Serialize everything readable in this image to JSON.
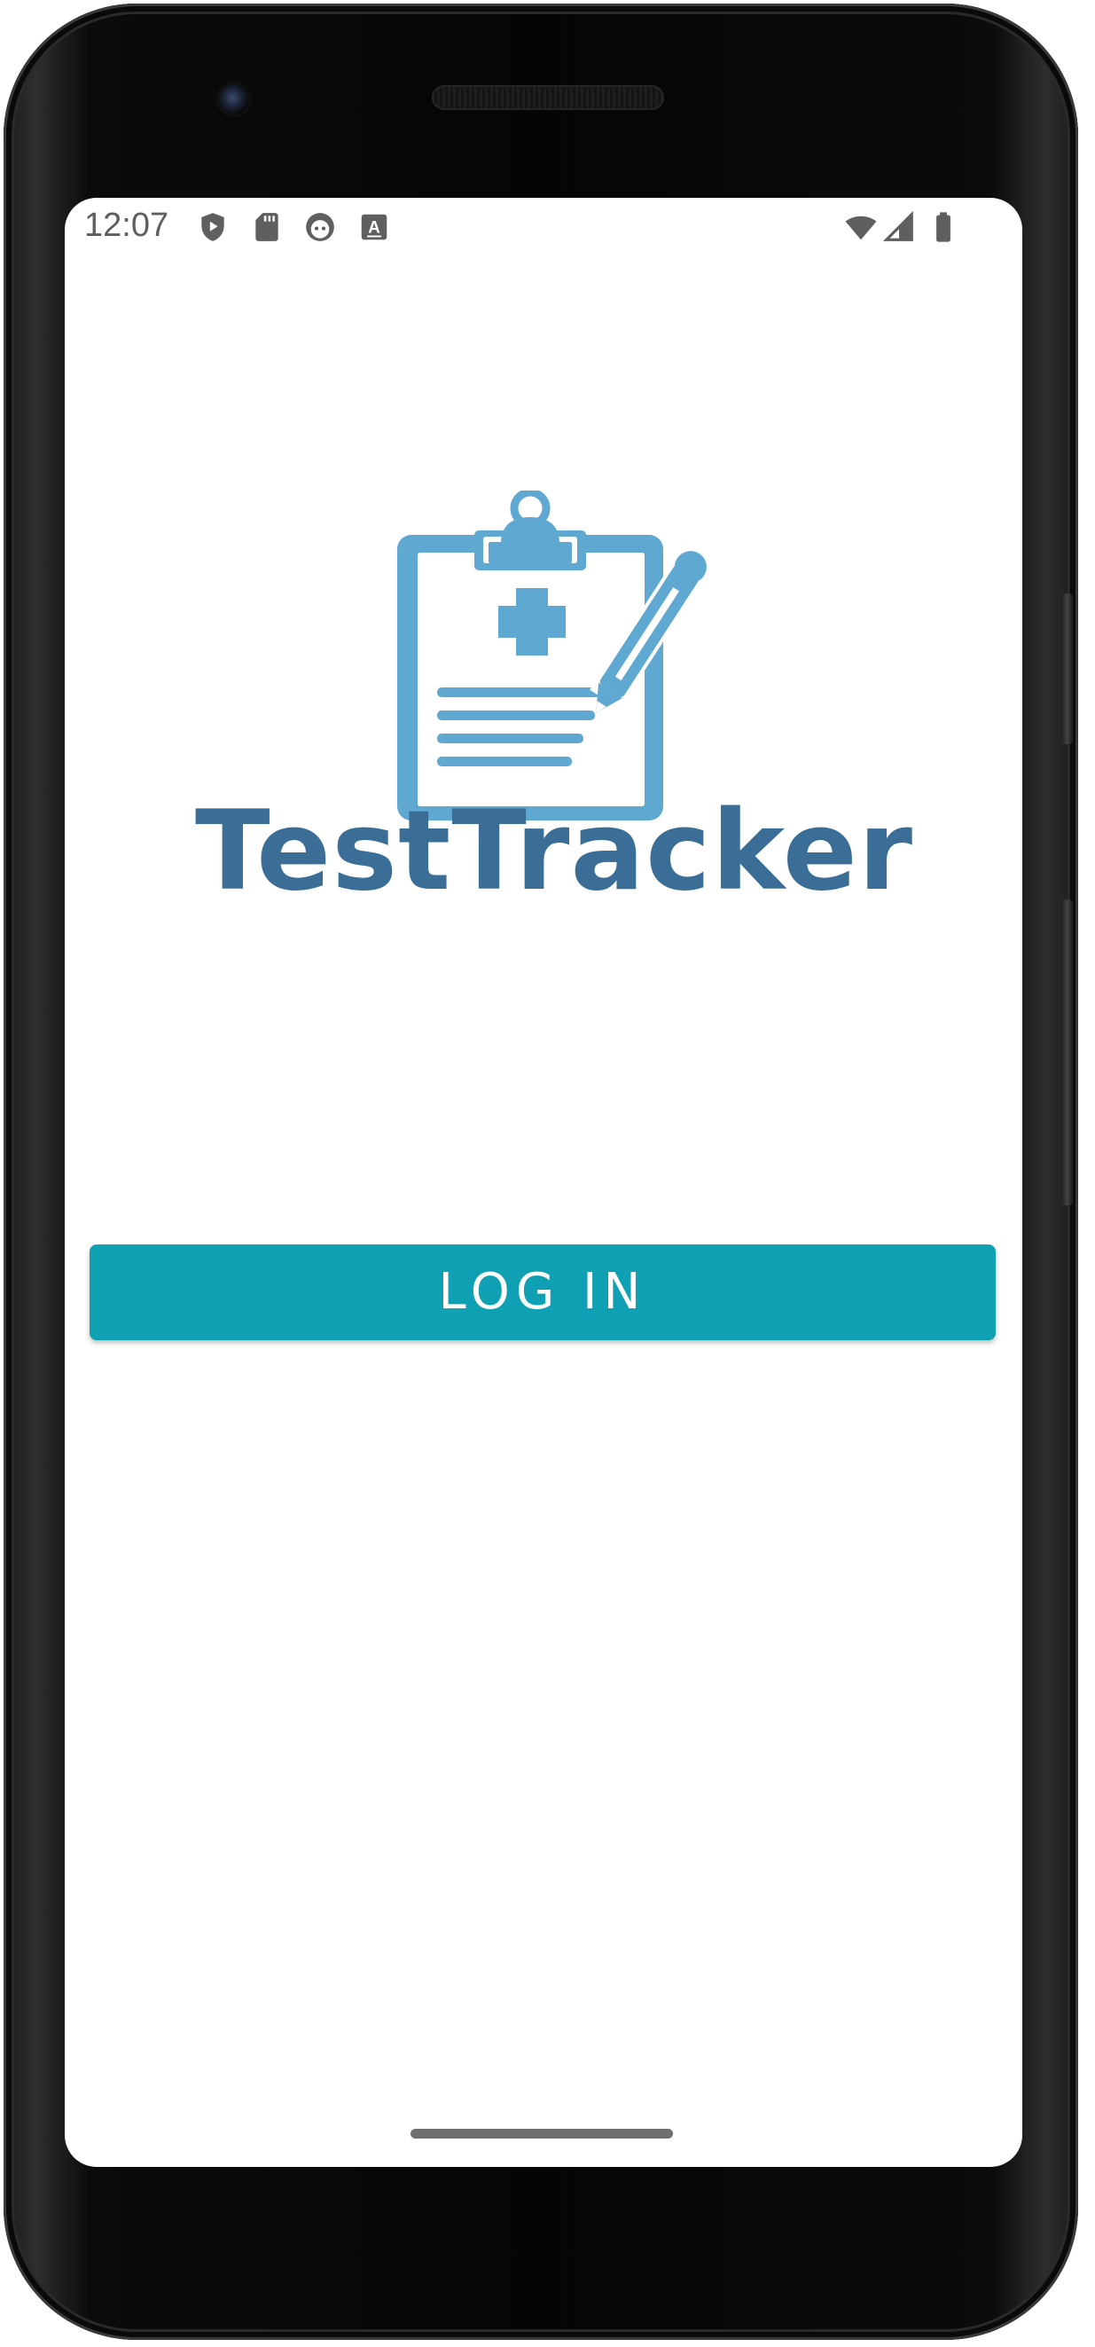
{
  "status_bar": {
    "time": "12:07",
    "left_icons": [
      "shield-play-icon",
      "sd-card-icon",
      "android-face-icon",
      "keyboard-a-icon"
    ],
    "right_icons": [
      "wifi-icon",
      "cell-signal-icon",
      "battery-icon"
    ]
  },
  "logo": {
    "name": "TestTracker",
    "icon": "clipboard-medical-pencil-icon",
    "colors": {
      "icon": "#5ea8d2",
      "text": "#3a6e96"
    }
  },
  "actions": {
    "login_label": "LOG IN",
    "login_color": "#0fa1b3"
  },
  "colors": {
    "screen_background": "#ffffff",
    "status_text": "#5f5f5f"
  }
}
